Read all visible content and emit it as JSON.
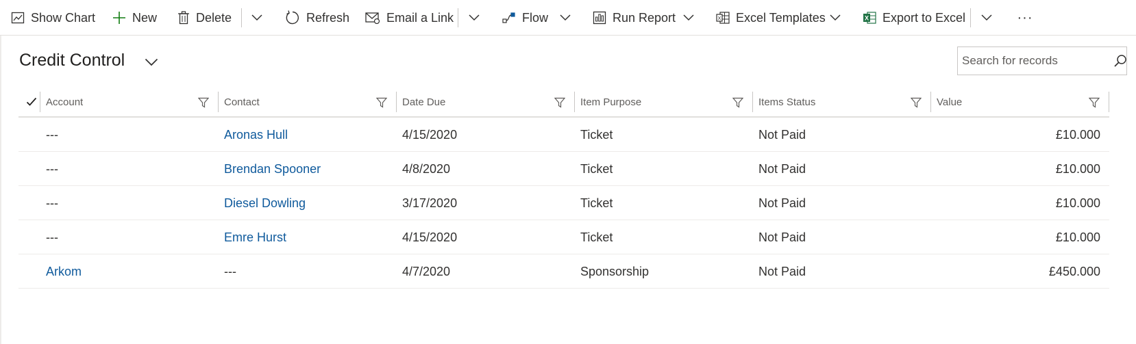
{
  "toolbar": {
    "show_chart": "Show Chart",
    "new": "New",
    "delete": "Delete",
    "refresh": "Refresh",
    "email_link": "Email a Link",
    "flow": "Flow",
    "run_report": "Run Report",
    "excel_templates": "Excel Templates",
    "export_excel": "Export to Excel",
    "more": "···"
  },
  "view": {
    "title": "Credit Control"
  },
  "search": {
    "placeholder": "Search for records",
    "value": ""
  },
  "grid": {
    "columns": [
      "Account",
      "Contact",
      "Date Due",
      "Item Purpose",
      "Items Status",
      "Value"
    ],
    "rows": [
      {
        "account": "---",
        "contact": "Aronas Hull",
        "date_due": "4/15/2020",
        "purpose": "Ticket",
        "status": "Not Paid",
        "value": "£10.000"
      },
      {
        "account": "---",
        "contact": "Brendan Spooner",
        "date_due": "4/8/2020",
        "purpose": "Ticket",
        "status": "Not Paid",
        "value": "£10.000"
      },
      {
        "account": "---",
        "contact": "Diesel Dowling",
        "date_due": "3/17/2020",
        "purpose": "Ticket",
        "status": "Not Paid",
        "value": "£10.000"
      },
      {
        "account": "---",
        "contact": "Emre Hurst",
        "date_due": "4/15/2020",
        "purpose": "Ticket",
        "status": "Not Paid",
        "value": "£10.000"
      },
      {
        "account": "Arkom",
        "contact": "---",
        "date_due": "4/7/2020",
        "purpose": "Sponsorship",
        "status": "Not Paid",
        "value": "£450.000"
      }
    ]
  },
  "colors": {
    "link": "#0f5a9c",
    "new_icon": "#107c10",
    "excel_icon": "#217346",
    "text": "#323130",
    "muted": "#605e5c"
  },
  "icons": [
    "chart-icon",
    "plus-icon",
    "trash-icon",
    "refresh-icon",
    "email-link-icon",
    "flow-icon",
    "report-icon",
    "excel-template-icon",
    "excel-icon",
    "chevron-down-icon",
    "filter-icon",
    "search-icon",
    "checkmark-icon"
  ]
}
